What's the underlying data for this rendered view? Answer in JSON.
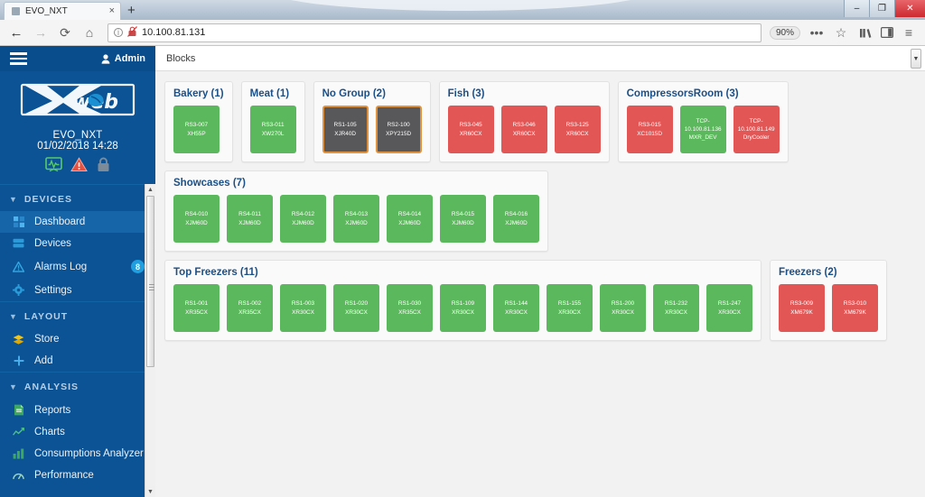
{
  "browser": {
    "tab_title": "EVO_NXT",
    "tab_close": "×",
    "new_tab": "+",
    "back": "←",
    "forward": "→",
    "reload": "⟳",
    "home": "⌂",
    "info_icon": "i",
    "insecure_icon": "✕",
    "url": "10.100.81.131",
    "zoom": "90%",
    "more": "•••",
    "bookmark": "☆",
    "library": "Ⅾ∖",
    "sidebar_toggle": "▥",
    "menu": "≡",
    "minimize": "–",
    "restore": "❐",
    "close": "✕"
  },
  "sidebar": {
    "user": "Admin",
    "user_icon": "👤",
    "device_name": "EVO_NXT",
    "datetime": "01/02/2018 14:28",
    "sections": [
      {
        "title": "DEVICES",
        "items": [
          {
            "label": "Dashboard",
            "icon": "dashboard-icon",
            "active": true,
            "badge": ""
          },
          {
            "label": "Devices",
            "icon": "devices-icon",
            "active": false,
            "badge": ""
          },
          {
            "label": "Alarms Log",
            "icon": "alarm-icon",
            "active": false,
            "badge": "8"
          },
          {
            "label": "Settings",
            "icon": "gear-icon",
            "active": false,
            "badge": ""
          }
        ]
      },
      {
        "title": "LAYOUT",
        "items": [
          {
            "label": "Store",
            "icon": "store-icon",
            "active": false,
            "badge": ""
          },
          {
            "label": "Add",
            "icon": "plus-icon",
            "active": false,
            "badge": ""
          }
        ]
      },
      {
        "title": "ANALYSIS",
        "items": [
          {
            "label": "Reports",
            "icon": "reports-icon",
            "active": false,
            "badge": ""
          },
          {
            "label": "Charts",
            "icon": "charts-icon",
            "active": false,
            "badge": ""
          },
          {
            "label": "Consumptions Analyzer",
            "icon": "bars-icon",
            "active": false,
            "badge": ""
          },
          {
            "label": "Performance",
            "icon": "performance-icon",
            "active": false,
            "badge": ""
          }
        ]
      }
    ]
  },
  "main": {
    "header_label": "Blocks",
    "rows": [
      {
        "groups": [
          {
            "title": "Bakery (1)",
            "tiles": [
              {
                "id": "RS3-007",
                "model": "XH55P",
                "state": "green"
              }
            ]
          },
          {
            "title": "Meat (1)",
            "tiles": [
              {
                "id": "RS3-011",
                "model": "XW270L",
                "state": "green"
              }
            ]
          },
          {
            "title": "No Group (2)",
            "tiles": [
              {
                "id": "RS1-105",
                "model": "XJR40D",
                "state": "grey"
              },
              {
                "id": "RS2-100",
                "model": "XPY215D",
                "state": "grey"
              }
            ]
          },
          {
            "title": "Fish (3)",
            "tiles": [
              {
                "id": "RS3-045",
                "model": "XR60CX",
                "state": "red"
              },
              {
                "id": "RS3-046",
                "model": "XR60CX",
                "state": "red"
              },
              {
                "id": "RS3-125",
                "model": "XR60CX",
                "state": "red"
              }
            ]
          },
          {
            "title": "CompressorsRoom (3)",
            "tiles": [
              {
                "id": "RS3-015",
                "model": "XC1015D",
                "state": "red"
              },
              {
                "id": "TCP-10.100.81.136",
                "model": "MXR_DEV",
                "state": "green"
              },
              {
                "id": "TCP-10.100.81.149",
                "model": "DryCooler",
                "state": "red"
              }
            ]
          }
        ]
      },
      {
        "groups": [
          {
            "title": "Showcases (7)",
            "tiles": [
              {
                "id": "RS4-010",
                "model": "XJM60D",
                "state": "green"
              },
              {
                "id": "RS4-011",
                "model": "XJM60D",
                "state": "green"
              },
              {
                "id": "RS4-012",
                "model": "XJM60D",
                "state": "green"
              },
              {
                "id": "RS4-013",
                "model": "XJM60D",
                "state": "green"
              },
              {
                "id": "RS4-014",
                "model": "XJM60D",
                "state": "green"
              },
              {
                "id": "RS4-015",
                "model": "XJM60D",
                "state": "green"
              },
              {
                "id": "RS4-016",
                "model": "XJM60D",
                "state": "green"
              }
            ]
          }
        ]
      },
      {
        "groups": [
          {
            "title": "Top Freezers (11)",
            "tiles": [
              {
                "id": "RS1-001",
                "model": "XR35CX",
                "state": "green"
              },
              {
                "id": "RS1-002",
                "model": "XR35CX",
                "state": "green"
              },
              {
                "id": "RS1-003",
                "model": "XR30CX",
                "state": "green"
              },
              {
                "id": "RS1-020",
                "model": "XR30CX",
                "state": "green"
              },
              {
                "id": "RS1-030",
                "model": "XR35CX",
                "state": "green"
              },
              {
                "id": "RS1-109",
                "model": "XR30CX",
                "state": "green"
              },
              {
                "id": "RS1-144",
                "model": "XR30CX",
                "state": "green"
              },
              {
                "id": "RS1-155",
                "model": "XR30CX",
                "state": "green"
              },
              {
                "id": "RS1-200",
                "model": "XR30CX",
                "state": "green"
              },
              {
                "id": "RS1-232",
                "model": "XR30CX",
                "state": "green"
              },
              {
                "id": "RS1-247",
                "model": "XR30CX",
                "state": "green"
              }
            ]
          },
          {
            "title": "Freezers (2)",
            "tiles": [
              {
                "id": "RS3-009",
                "model": "XM679K",
                "state": "red"
              },
              {
                "id": "RS3-010",
                "model": "XM679K",
                "state": "red"
              }
            ]
          }
        ]
      }
    ]
  },
  "colors": {
    "brand_blue": "#0b5394",
    "ok_green": "#5cb85c",
    "alarm_red": "#e35656",
    "offline_grey": "#58585a",
    "offline_border": "#e0933c",
    "badge_blue": "#1f9fe0"
  }
}
